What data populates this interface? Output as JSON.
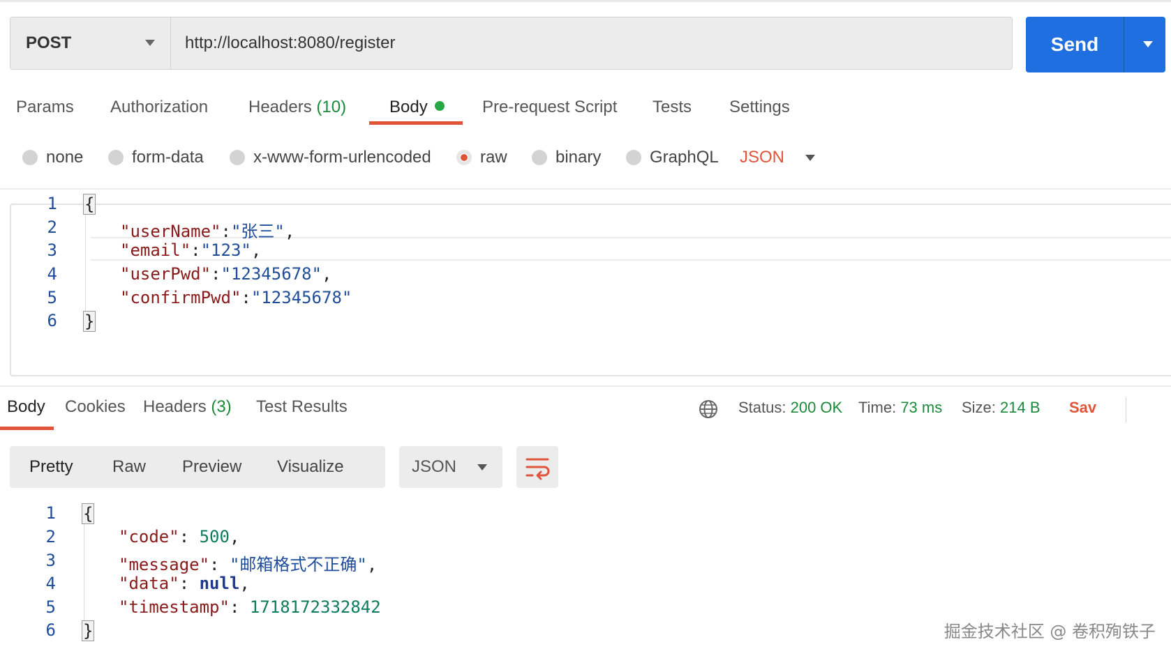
{
  "request": {
    "method": "POST",
    "url": "http://localhost:8080/register",
    "send_label": "Send"
  },
  "request_tabs": {
    "params": "Params",
    "authorization": "Authorization",
    "headers": "Headers",
    "headers_count": "(10)",
    "body": "Body",
    "pre_request": "Pre-request Script",
    "tests": "Tests",
    "settings": "Settings"
  },
  "body_types": {
    "none": "none",
    "form_data": "form-data",
    "urlencoded": "x-www-form-urlencoded",
    "raw": "raw",
    "binary": "binary",
    "graphql": "GraphQL",
    "selected": "raw",
    "language": "JSON"
  },
  "request_body": {
    "line_numbers": [
      "1",
      "2",
      "3",
      "4",
      "5",
      "6"
    ],
    "open_brace": "{",
    "close_brace": "}",
    "fields": [
      {
        "key": "\"userName\"",
        "sep": ":",
        "value": "\"张三\"",
        "trail": ","
      },
      {
        "key": "\"email\"",
        "sep": ":",
        "value": "\"123\"",
        "trail": ","
      },
      {
        "key": "\"userPwd\"",
        "sep": ":",
        "value": "\"12345678\"",
        "trail": ","
      },
      {
        "key": "\"confirmPwd\"",
        "sep": ":",
        "value": "\"12345678\"",
        "trail": ""
      }
    ]
  },
  "response_tabs": {
    "body": "Body",
    "cookies": "Cookies",
    "headers": "Headers",
    "headers_count": "(3)",
    "test_results": "Test Results"
  },
  "response_status": {
    "status_label": "Status:",
    "status_value": "200 OK",
    "time_label": "Time:",
    "time_value": "73 ms",
    "size_label": "Size:",
    "size_value": "214 B",
    "save_label": "Sav"
  },
  "response_view": {
    "pretty": "Pretty",
    "raw": "Raw",
    "preview": "Preview",
    "visualize": "Visualize",
    "format": "JSON"
  },
  "response_body": {
    "line_numbers": [
      "1",
      "2",
      "3",
      "4",
      "5",
      "6"
    ],
    "open_brace": "{",
    "close_brace": "}",
    "code_key": "\"code\"",
    "code_value": "500",
    "message_key": "\"message\"",
    "message_value": "\"邮箱格式不正确\"",
    "data_key": "\"data\"",
    "data_value": "null",
    "timestamp_key": "\"timestamp\"",
    "timestamp_value": "1718172332842",
    "colon": ": ",
    "comma": ","
  },
  "watermark": "掘金技术社区 @ 卷积殉铁子",
  "colors": {
    "accent": "#e0553a",
    "send_blue": "#1f6fe0",
    "status_green": "#1b8a3a"
  }
}
